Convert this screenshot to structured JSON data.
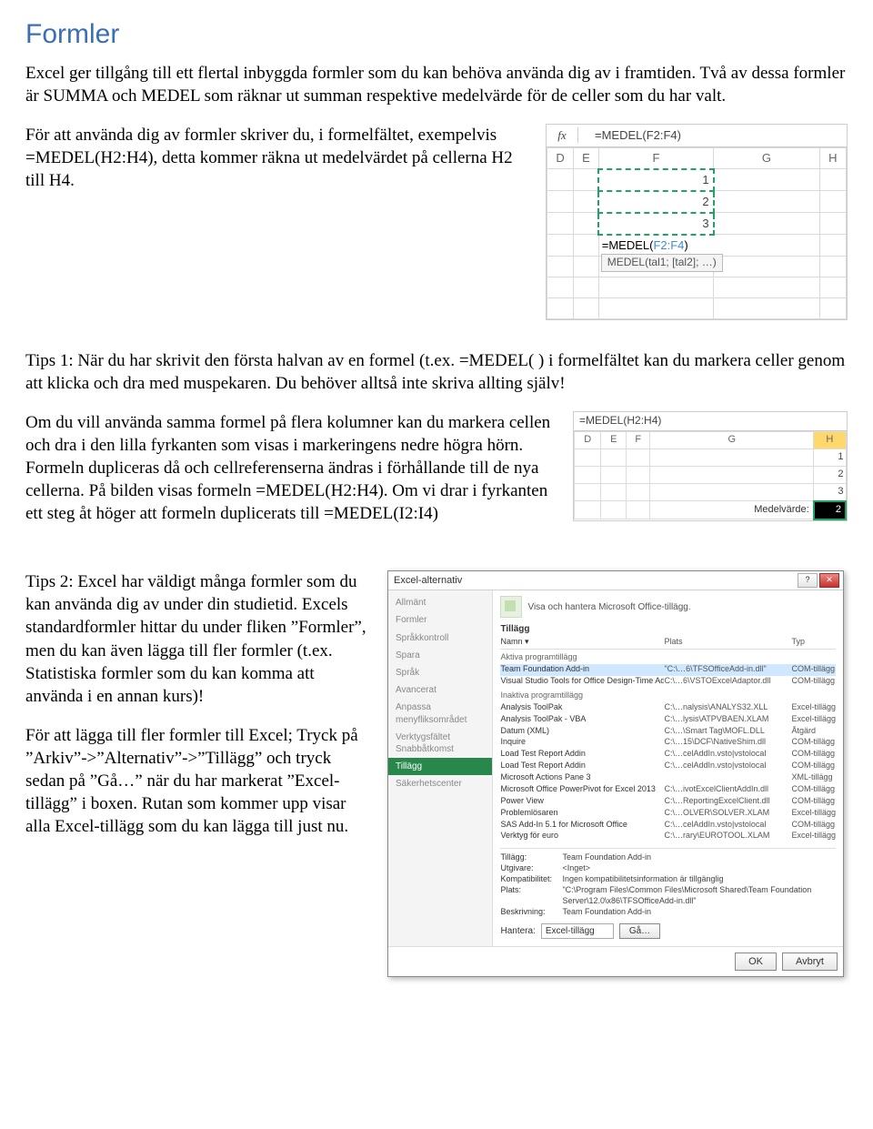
{
  "title": "Formler",
  "p1": "Excel ger tillgång till ett flertal inbyggda formler som du kan behöva använda dig av i framtiden. Två av dessa formler är SUMMA och MEDEL som räknar ut summan respektive medelvärde för de celler som du har valt.",
  "p2": "För att använda dig av formler skriver du, i formelfältet, exempelvis =MEDEL(H2:H4), detta kommer räkna ut medelvärdet på cellerna H2 till H4.",
  "p3": "Tips 1: När du har skrivit den första halvan av en formel (t.ex. =MEDEL( ) i formelfältet kan du markera celler genom att klicka och dra med muspekaren. Du behöver alltså inte skriva allting själv!",
  "p4": "Om du vill använda samma formel på flera kolumner kan du markera cellen och dra i den lilla fyrkanten som visas i markeringens nedre högra hörn. Formeln dupliceras då och cellreferenserna ändras i förhållande till de nya cellerna. På bilden visas formeln =MEDEL(H2:H4). Om vi drar i fyrkanten ett steg åt höger att formeln duplicerats till =MEDEL(I2:I4)",
  "p5": "Tips 2: Excel har väldigt många formler som du kan använda dig av under din studietid. Excels standardformler hittar du under fliken ”Formler”, men du kan även lägga till fler formler (t.ex. Statistiska formler som du kan komma att använda i en annan kurs)!",
  "p6": "För att lägga till fler formler till Excel; Tryck på ”Arkiv”->”Alternativ”->”Tillägg” och tryck sedan på ”Gå…” när du har markerat ”Excel-tillägg” i boxen. Rutan som kommer upp visar alla Excel-tillägg som du kan lägga till just nu.",
  "fig1": {
    "fx_label": "fx",
    "fx_value": "=MEDEL(F2:F4)",
    "cols": [
      "D",
      "E",
      "F",
      "G",
      "H"
    ],
    "vals": [
      "1",
      "2",
      "3"
    ],
    "active_fn": "=MEDEL(",
    "active_rng": "F2:F4",
    "active_close": ")",
    "hint": "MEDEL(tal1; [tal2]; …)"
  },
  "fig2": {
    "fbar": "=MEDEL(H2:H4)",
    "cols": [
      "D",
      "E",
      "F",
      "G",
      "H"
    ],
    "rows": [
      "1",
      "2",
      "3"
    ],
    "label": "Medelvärde:",
    "val": "2"
  },
  "dlg": {
    "title": "Excel-alternativ",
    "nav": [
      "Allmänt",
      "Formler",
      "Språkkontroll",
      "Spara",
      "Språk",
      "Avancerat",
      "Anpassa menyfliksområdet",
      "Verktygsfältet Snabbåtkomst",
      "Tillägg",
      "Säkerhetscenter"
    ],
    "nav_sel": 8,
    "hdr": "Visa och hantera Microsoft Office-tillägg.",
    "section": "Tillägg",
    "list_hdr": {
      "c1": "Namn ▾",
      "c2": "Plats",
      "c3": "Typ"
    },
    "grp1": "Aktiva programtillägg",
    "items1": [
      {
        "c1": "Team Foundation Add-in",
        "c2": "\"C:\\…6\\TFSOfficeAdd-in.dll\"",
        "c3": "COM-tillägg",
        "hl": true
      },
      {
        "c1": "Visual Studio Tools for Office Design-Time Adaptor for Excel",
        "c2": "C:\\…6\\VSTOExcelAdaptor.dll",
        "c3": "COM-tillägg"
      }
    ],
    "grp2": "Inaktiva programtillägg",
    "items2": [
      {
        "c1": "Analysis ToolPak",
        "c2": "C:\\…nalysis\\ANALYS32.XLL",
        "c3": "Excel-tillägg"
      },
      {
        "c1": "Analysis ToolPak - VBA",
        "c2": "C:\\…lysis\\ATPVBAEN.XLAM",
        "c3": "Excel-tillägg"
      },
      {
        "c1": "Datum (XML)",
        "c2": "C:\\…\\Smart Tag\\MOFL.DLL",
        "c3": "Åtgärd"
      },
      {
        "c1": "Inquire",
        "c2": "C:\\…15\\DCF\\NativeShim.dll",
        "c3": "COM-tillägg"
      },
      {
        "c1": "Load Test Report Addin",
        "c2": "C:\\…celAddIn.vsto|vstolocal",
        "c3": "COM-tillägg"
      },
      {
        "c1": "Load Test Report Addin",
        "c2": "C:\\…celAddIn.vsto|vstolocal",
        "c3": "COM-tillägg"
      },
      {
        "c1": "Microsoft Actions Pane 3",
        "c2": "",
        "c3": "XML-tillägg"
      },
      {
        "c1": "Microsoft Office PowerPivot for Excel 2013",
        "c2": "C:\\…ivotExcelClientAddIn.dll",
        "c3": "COM-tillägg"
      },
      {
        "c1": "Power View",
        "c2": "C:\\…ReportingExcelClient.dll",
        "c3": "COM-tillägg"
      },
      {
        "c1": "Problemlösaren",
        "c2": "C:\\…OLVER\\SOLVER.XLAM",
        "c3": "Excel-tillägg"
      },
      {
        "c1": "SAS Add-In 5.1 for Microsoft Office",
        "c2": "C:\\…celAddIn.vsto|vstolocal",
        "c3": "COM-tillägg"
      },
      {
        "c1": "Verktyg för euro",
        "c2": "C:\\…rary\\EUROTOOL.XLAM",
        "c3": "Excel-tillägg"
      }
    ],
    "meta": {
      "k_add": "Tillägg:",
      "v_add": "Team Foundation Add-in",
      "k_pub": "Utgivare:",
      "v_pub": "<Inget>",
      "k_comp": "Kompatibilitet:",
      "v_comp": "Ingen kompatibilitetsinformation är tillgänglig",
      "k_loc": "Plats:",
      "v_loc": "\"C:\\Program Files\\Common Files\\Microsoft Shared\\Team Foundation Server\\12.0\\x86\\TFSOfficeAdd-in.dll\"",
      "k_desc": "Beskrivning:",
      "v_desc": "Team Foundation Add-in"
    },
    "manage_label": "Hantera:",
    "manage_value": "Excel-tillägg",
    "go": "Gå…",
    "ok": "OK",
    "cancel": "Avbryt"
  }
}
